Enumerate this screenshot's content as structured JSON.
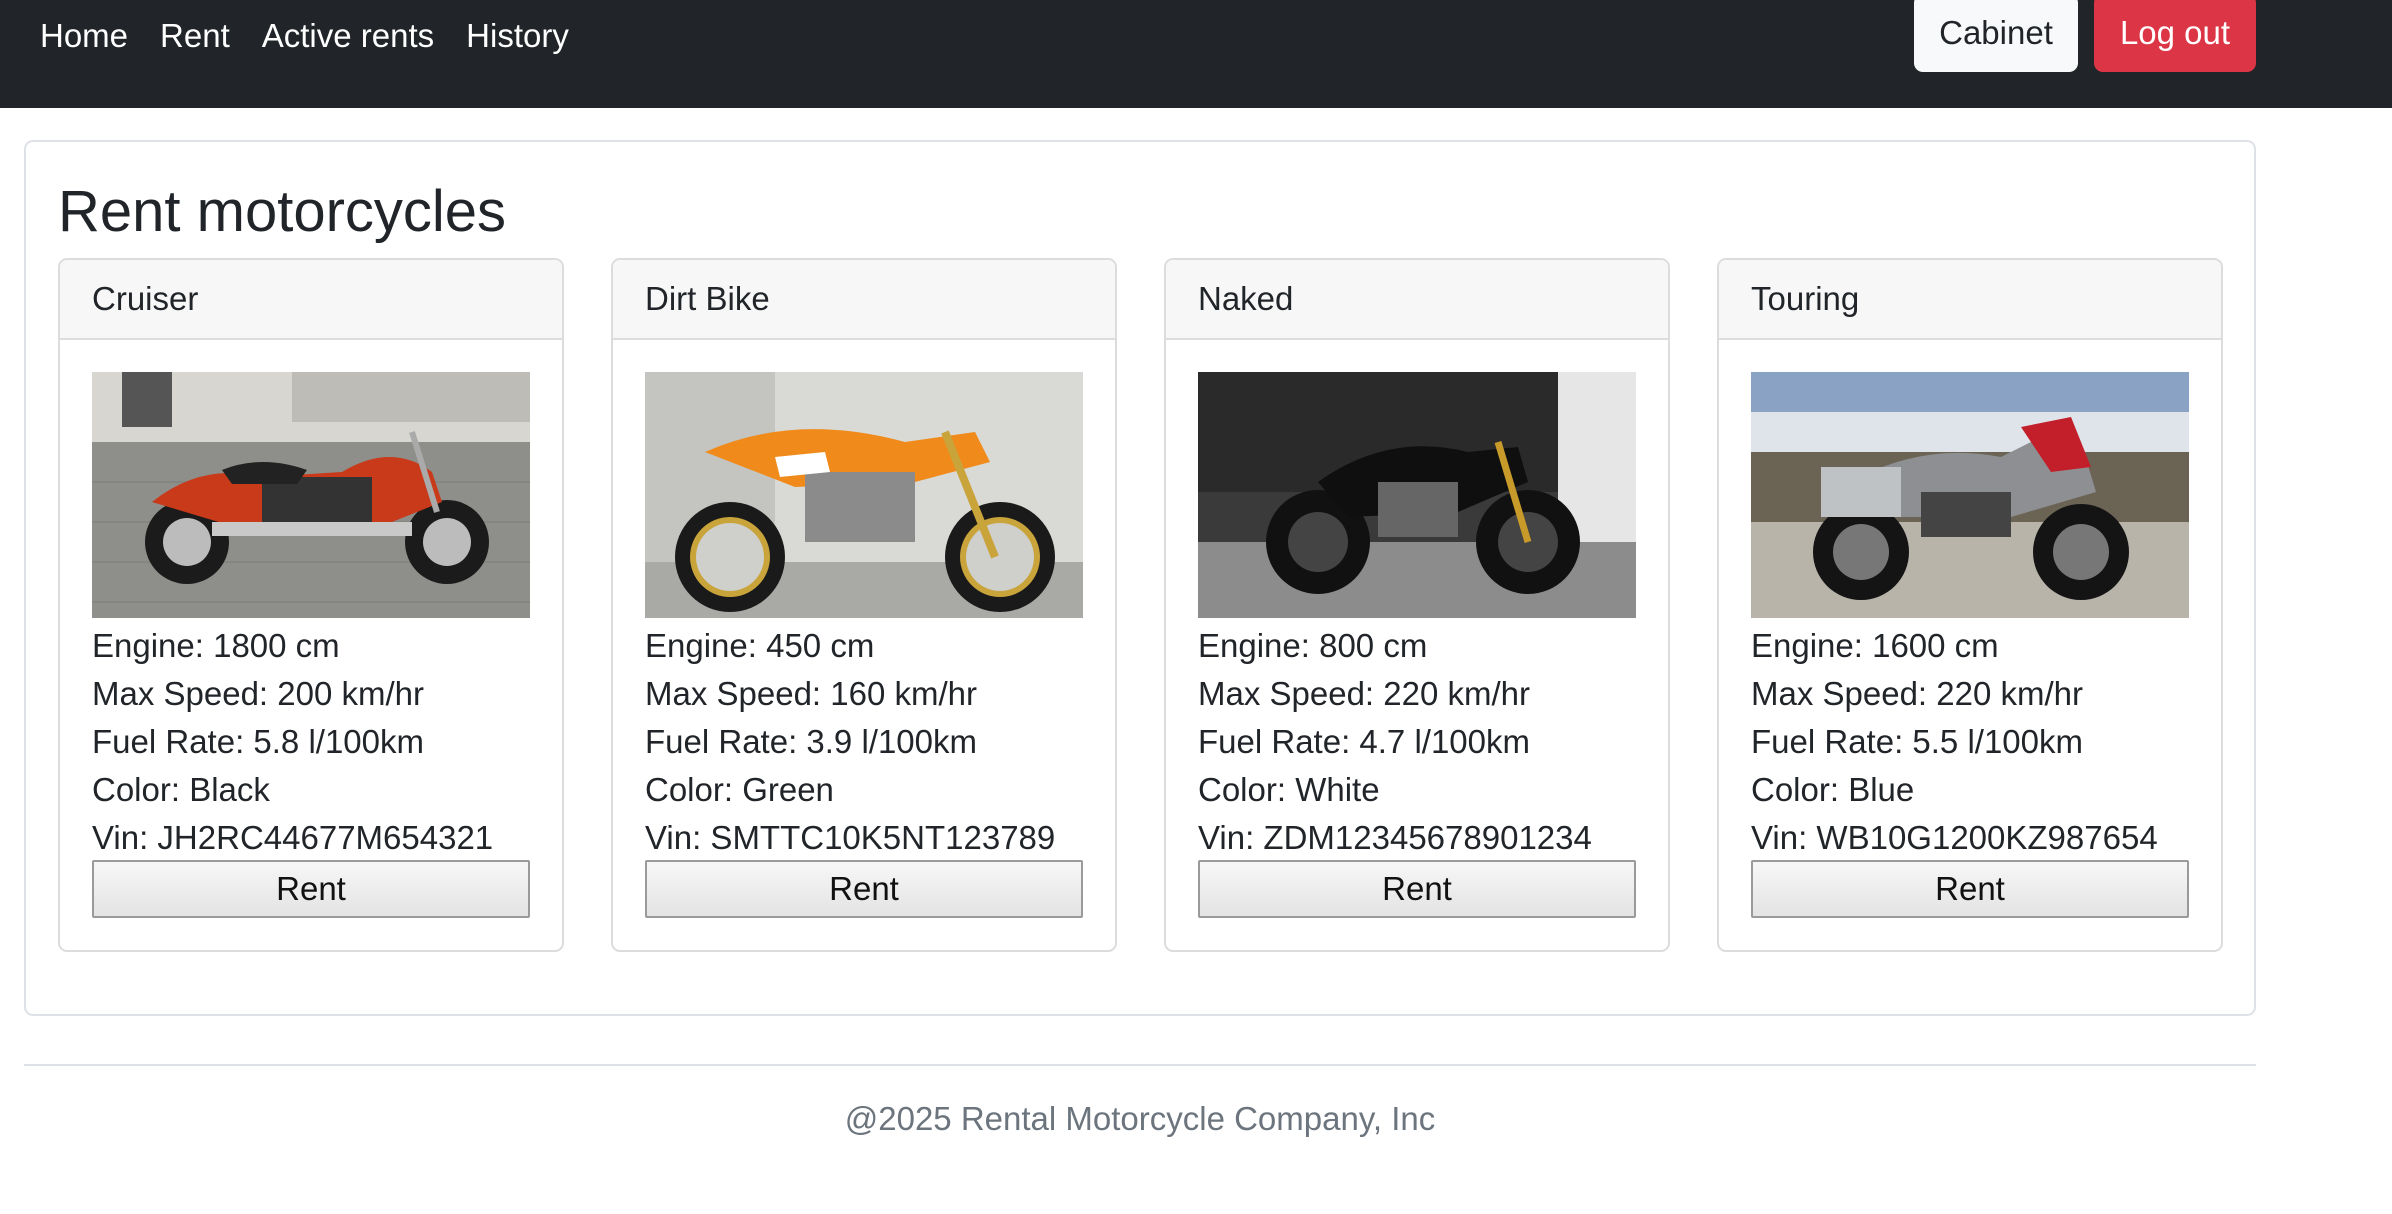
{
  "nav": {
    "links": [
      "Home",
      "Rent",
      "Active rents",
      "History"
    ],
    "cabinet_label": "Cabinet",
    "logout_label": "Log out"
  },
  "main": {
    "title": "Rent motorcycles",
    "cards": [
      {
        "name": "Cruiser",
        "image_icon": "cruiser-motorcycle-photo",
        "specs": [
          "Engine: 1800 cm",
          "Max Speed: 200 km/hr",
          "Fuel Rate: 5.8 l/100km",
          "Color: Black",
          "Vin: JH2RC44677M654321"
        ],
        "rent_label": "Rent"
      },
      {
        "name": "Dirt Bike",
        "image_icon": "dirt-bike-photo",
        "specs": [
          "Engine: 450 cm",
          "Max Speed: 160 km/hr",
          "Fuel Rate: 3.9 l/100km",
          "Color: Green",
          "Vin: SMTTC10K5NT123789"
        ],
        "rent_label": "Rent"
      },
      {
        "name": "Naked",
        "image_icon": "naked-motorcycle-photo",
        "specs": [
          "Engine: 800 cm",
          "Max Speed: 220 km/hr",
          "Fuel Rate: 4.7 l/100km",
          "Color: White",
          "Vin: ZDM12345678901234"
        ],
        "rent_label": "Rent"
      },
      {
        "name": "Touring",
        "image_icon": "touring-motorcycle-photo",
        "specs": [
          "Engine: 1600 cm",
          "Max Speed: 220 km/hr",
          "Fuel Rate: 5.5 l/100km",
          "Color: Blue",
          "Vin: WB10G1200KZ987654"
        ],
        "rent_label": "Rent"
      }
    ]
  },
  "footer": {
    "text": "@2025 Rental Motorcycle Company, Inc"
  },
  "colors": {
    "navbar": "#212529",
    "logout": "#dc3545",
    "cabinet": "#f8f9fa"
  }
}
